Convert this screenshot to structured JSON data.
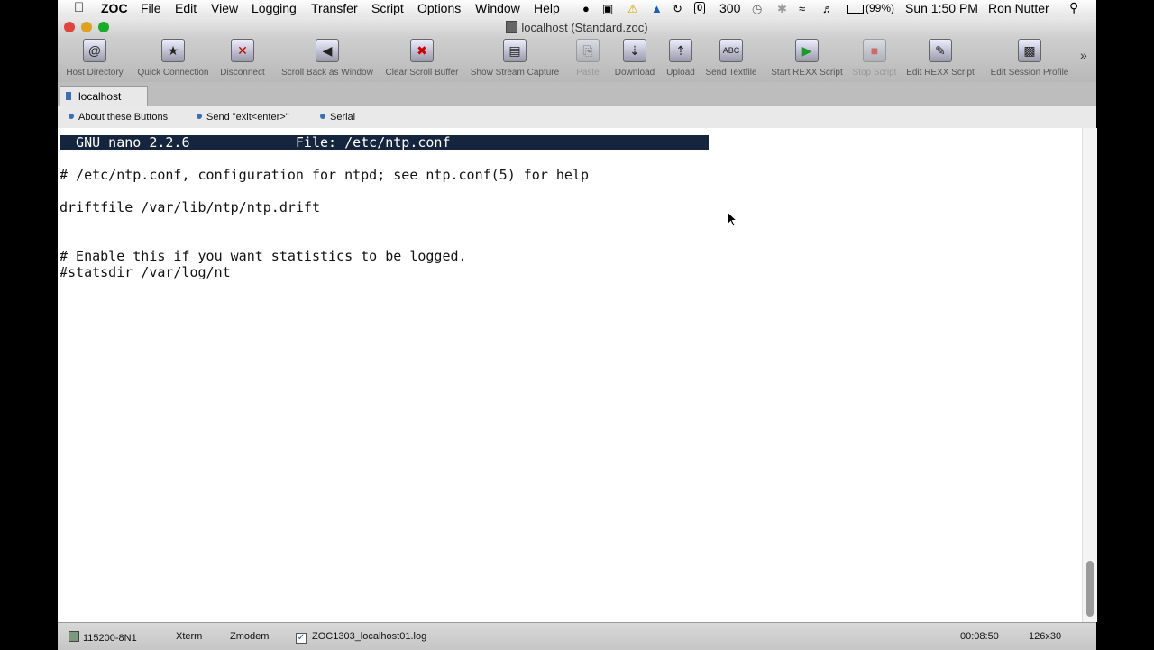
{
  "menubar": {
    "app_name": "ZOC",
    "items": [
      "File",
      "Edit",
      "View",
      "Logging",
      "Transfer",
      "Script",
      "Options",
      "Window",
      "Help"
    ],
    "status_number": "300",
    "battery": "(99%)",
    "clock": "Sun 1:50 PM",
    "user": "Ron Nutter"
  },
  "window": {
    "title": "localhost (Standard.zoc)"
  },
  "toolbar": {
    "buttons": [
      {
        "label": "Host Directory",
        "icon": "at-sign-icon"
      },
      {
        "label": "Quick Connection",
        "icon": "star-terminal-icon"
      },
      {
        "label": "Disconnect",
        "icon": "terminal-x-icon"
      },
      {
        "label": "Scroll Back as Window",
        "icon": "scroll-back-icon"
      },
      {
        "label": "Clear Scroll Buffer",
        "icon": "clear-x-icon"
      },
      {
        "label": "Show Stream Capture",
        "icon": "capture-icon"
      },
      {
        "label": "Paste",
        "icon": "paste-icon"
      },
      {
        "label": "Download",
        "icon": "download-icon"
      },
      {
        "label": "Upload",
        "icon": "upload-icon"
      },
      {
        "label": "Send Textfile",
        "icon": "send-textfile-icon"
      },
      {
        "label": "Start REXX Script",
        "icon": "play-icon"
      },
      {
        "label": "Stop Script",
        "icon": "stop-icon"
      },
      {
        "label": "Edit REXX Script",
        "icon": "edit-pencil-icon"
      },
      {
        "label": "Edit Session Profile",
        "icon": "session-profile-icon"
      }
    ],
    "overflow": "»"
  },
  "tabs": {
    "active": "localhost"
  },
  "user_buttons": [
    "About these Buttons",
    "Send \"exit<enter>\"",
    "Serial"
  ],
  "terminal": {
    "nano_header": "  GNU nano 2.2.6             File: /etc/ntp.conf",
    "lines": [
      "# /etc/ntp.conf, configuration for ntpd; see ntp.conf(5) for help",
      "driftfile /var/lib/ntp/ntp.drift",
      "# Enable this if you want statistics to be logged.",
      "#statsdir /var/log/nt"
    ]
  },
  "statusbar": {
    "serial": "115200-8N1",
    "emulation": "Xterm",
    "transfer": "Zmodem",
    "logfile": "ZOC1303_localhost01.log",
    "timer": "00:08:50",
    "size": "126x30"
  },
  "colors": {
    "nano_header_bg": "#15253d",
    "accent": "#3a6fb0"
  }
}
